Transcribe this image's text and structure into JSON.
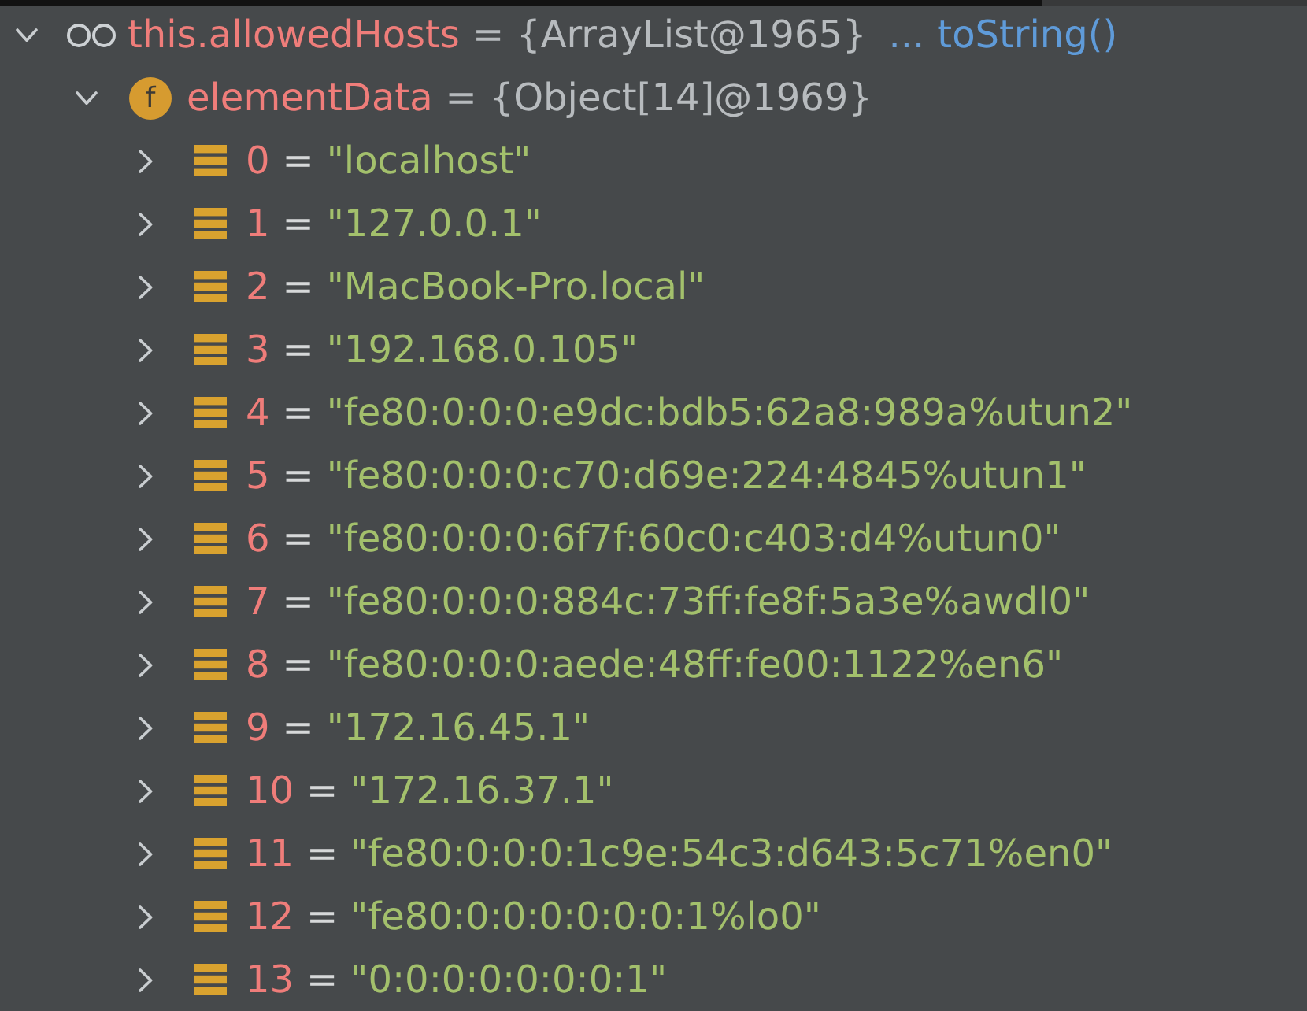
{
  "tree": [
    {
      "kind": "watch",
      "name": "this.allowedHosts",
      "separator": "=",
      "value": "{ArrayList@1965}",
      "ellipsis": "...",
      "link": "toString()",
      "expanded": true,
      "children": [
        {
          "kind": "field",
          "badge": "f",
          "name": "elementData",
          "separator": "=",
          "value": "{Object[14]@1969}",
          "expanded": true,
          "children": [
            {
              "kind": "element",
              "name": "0",
              "separator": "=",
              "value": "\"localhost\"",
              "expanded": false
            },
            {
              "kind": "element",
              "name": "1",
              "separator": "=",
              "value": "\"127.0.0.1\"",
              "expanded": false
            },
            {
              "kind": "element",
              "name": "2",
              "separator": "=",
              "value": "\"MacBook-Pro.local\"",
              "expanded": false
            },
            {
              "kind": "element",
              "name": "3",
              "separator": "=",
              "value": "\"192.168.0.105\"",
              "expanded": false
            },
            {
              "kind": "element",
              "name": "4",
              "separator": "=",
              "value": "\"fe80:0:0:0:e9dc:bdb5:62a8:989a%utun2\"",
              "expanded": false
            },
            {
              "kind": "element",
              "name": "5",
              "separator": "=",
              "value": "\"fe80:0:0:0:c70:d69e:224:4845%utun1\"",
              "expanded": false
            },
            {
              "kind": "element",
              "name": "6",
              "separator": "=",
              "value": "\"fe80:0:0:0:6f7f:60c0:c403:d4%utun0\"",
              "expanded": false
            },
            {
              "kind": "element",
              "name": "7",
              "separator": "=",
              "value": "\"fe80:0:0:0:884c:73ff:fe8f:5a3e%awdl0\"",
              "expanded": false
            },
            {
              "kind": "element",
              "name": "8",
              "separator": "=",
              "value": "\"fe80:0:0:0:aede:48ff:fe00:1122%en6\"",
              "expanded": false
            },
            {
              "kind": "element",
              "name": "9",
              "separator": "=",
              "value": "\"172.16.45.1\"",
              "expanded": false
            },
            {
              "kind": "element",
              "name": "10",
              "separator": "=",
              "value": "\"172.16.37.1\"",
              "expanded": false
            },
            {
              "kind": "element",
              "name": "11",
              "separator": "=",
              "value": "\"fe80:0:0:0:1c9e:54c3:d643:5c71%en0\"",
              "expanded": false
            },
            {
              "kind": "element",
              "name": "12",
              "separator": "=",
              "value": "\"fe80:0:0:0:0:0:0:1%lo0\"",
              "expanded": false
            },
            {
              "kind": "element",
              "name": "13",
              "separator": "=",
              "value": "\"0:0:0:0:0:0:0:1\"",
              "expanded": false
            }
          ]
        }
      ]
    }
  ]
}
